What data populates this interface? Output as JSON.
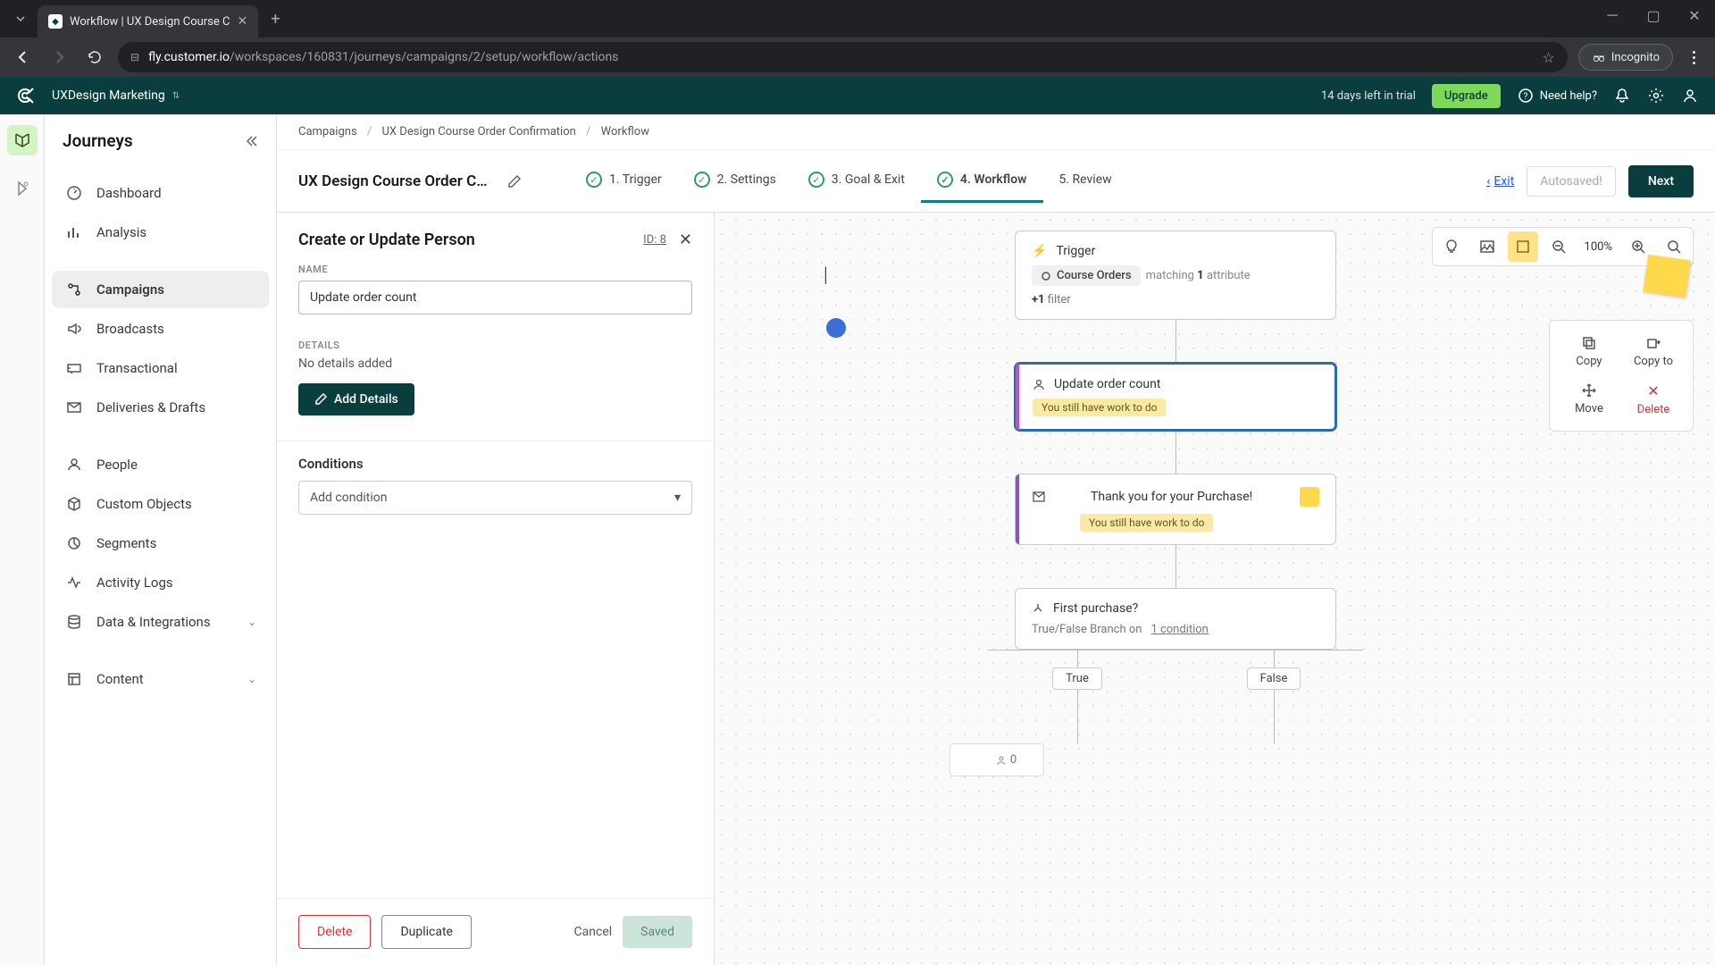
{
  "browser": {
    "tab_title": "Workflow | UX Design Course C",
    "url_domain": "fly.customer.io",
    "url_path": "/workspaces/160831/journeys/campaigns/2/setup/workflow/actions",
    "incognito_label": "Incognito"
  },
  "header": {
    "workspace": "UXDesign Marketing",
    "trial": "14 days left in trial",
    "upgrade": "Upgrade",
    "need_help": "Need help?"
  },
  "sidebar": {
    "title": "Journeys",
    "items": [
      {
        "label": "Dashboard"
      },
      {
        "label": "Analysis"
      },
      {
        "label": "Campaigns"
      },
      {
        "label": "Broadcasts"
      },
      {
        "label": "Transactional"
      },
      {
        "label": "Deliveries & Drafts"
      },
      {
        "label": "People"
      },
      {
        "label": "Custom Objects"
      },
      {
        "label": "Segments"
      },
      {
        "label": "Activity Logs"
      },
      {
        "label": "Data & Integrations"
      },
      {
        "label": "Content"
      }
    ]
  },
  "breadcrumbs": {
    "a": "Campaigns",
    "b": "UX Design Course Order Confirmation",
    "c": "Workflow"
  },
  "workflow": {
    "title": "UX Design Course Order Confir...",
    "steps": [
      {
        "label": "1. Trigger"
      },
      {
        "label": "2. Settings"
      },
      {
        "label": "3. Goal & Exit"
      },
      {
        "label": "4. Workflow"
      },
      {
        "label": "5. Review"
      }
    ],
    "exit": "Exit",
    "autosaved": "Autosaved!",
    "next": "Next"
  },
  "panel": {
    "title": "Create or Update Person",
    "id_label": "ID: 8",
    "name_label": "NAME",
    "name_value": "Update order count",
    "details_label": "DETAILS",
    "details_text": "No details added",
    "add_details": "Add Details",
    "conditions_title": "Conditions",
    "add_condition": "Add condition",
    "delete": "Delete",
    "duplicate": "Duplicate",
    "cancel": "Cancel",
    "saved": "Saved"
  },
  "canvas": {
    "zoom": "100%",
    "trigger_title": "Trigger",
    "trigger_chip": "Course Orders",
    "trigger_matching": "matching",
    "trigger_count": "1",
    "trigger_attribute": "attribute",
    "trigger_filter_plus": "+1",
    "trigger_filter": "filter",
    "node_update": "Update order count",
    "warning": "You still have work to do",
    "node_email": "Thank you for your Purchase!",
    "node_branch": "First purchase?",
    "branch_desc_a": "True/False Branch on ",
    "branch_desc_b": "1 condition",
    "branch_true": "True",
    "branch_false": "False",
    "delay_count": "0",
    "actions": {
      "copy": "Copy",
      "copy_to": "Copy to",
      "move": "Move",
      "delete": "Delete"
    }
  }
}
